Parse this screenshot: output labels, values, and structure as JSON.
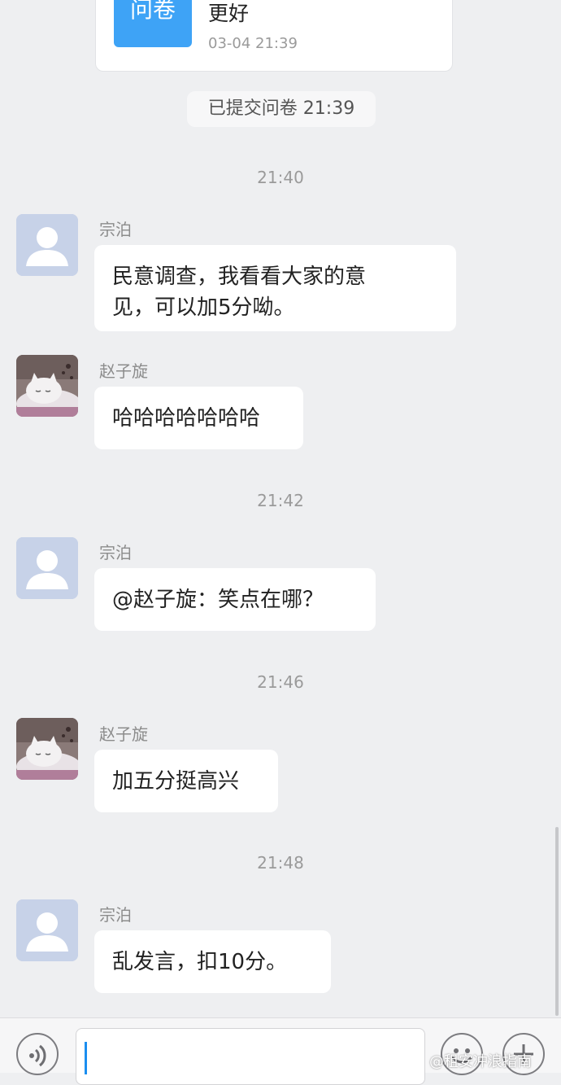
{
  "survey_card": {
    "thumb_text": "问卷",
    "title": "更好",
    "time": "03-04 21:39"
  },
  "system_notice": "已提交问卷 21:39",
  "messages": [
    {
      "timestamp": "21:40",
      "sender": "宗泊",
      "avatar": "default-avatar",
      "lines": [
        "民意调查，我看看大家的意",
        "见，可以加5分呦。"
      ]
    },
    {
      "sender": "赵子旋",
      "avatar": "cat-avatar",
      "lines": [
        "哈哈哈哈哈哈哈"
      ]
    },
    {
      "timestamp": "21:42",
      "sender": "宗泊",
      "avatar": "default-avatar",
      "lines": [
        "@赵子旋：笑点在哪？"
      ]
    },
    {
      "timestamp": "21:46",
      "sender": "赵子旋",
      "avatar": "cat-avatar",
      "lines": [
        "加五分挺高兴"
      ]
    },
    {
      "timestamp": "21:48",
      "sender": "宗泊",
      "avatar": "default-avatar",
      "lines": [
        "乱发言，扣10分。"
      ]
    }
  ],
  "input_bar": {
    "voice_icon": "voice-icon",
    "emoji_icon": "emoji-icon",
    "plus_icon": "plus-icon"
  },
  "watermark": "@租安冲浪指南",
  "colors": {
    "background": "#eeeff1",
    "bubble": "#ffffff",
    "survey_thumb": "#3ea3f6",
    "caret": "#1a8ef0",
    "default_avatar": "#c7d2e8"
  }
}
